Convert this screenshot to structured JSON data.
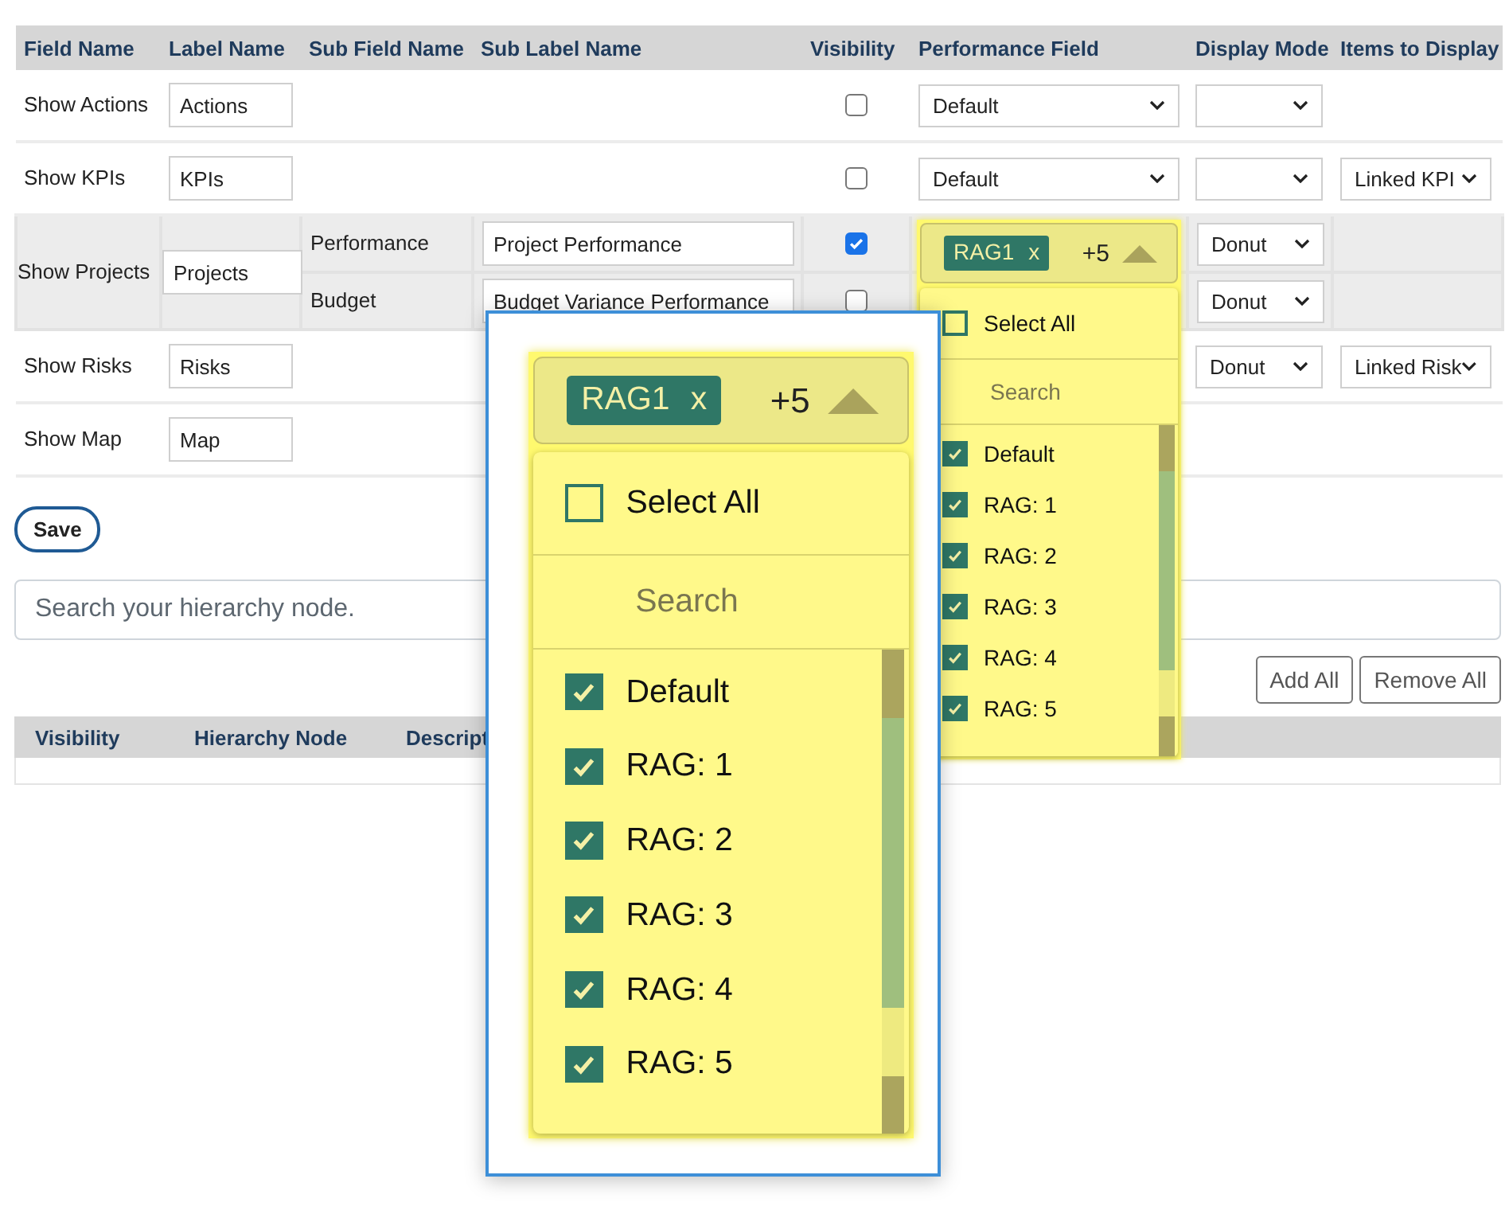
{
  "table": {
    "columns": [
      "Field Name",
      "Label Name",
      "Sub Field Name",
      "Sub Label Name",
      "Visibility",
      "Performance Field",
      "Display Mode",
      "Items to Display"
    ],
    "rows": [
      {
        "field": "Show Actions",
        "label": "Actions",
        "visible": false,
        "performance": "Default",
        "display_mode": {
          "kind": "select"
        }
      },
      {
        "field": "Show KPIs",
        "label": "KPIs",
        "visible": false,
        "performance": "Default",
        "display_mode": {
          "kind": "select"
        },
        "items": {
          "kind": "select",
          "value": "Linked KPI"
        }
      },
      {
        "field": "Show Projects",
        "label": "Projects",
        "sub_rows": [
          {
            "sub_field": "Performance",
            "sub_label": "Project Performance",
            "visible": true,
            "display_mode": {
              "kind": "select",
              "value": "Donut"
            }
          },
          {
            "sub_field": "Budget",
            "sub_label": "Budget Variance Performance",
            "visible": false,
            "display_mode": {
              "kind": "select",
              "value": "Donut"
            }
          }
        ]
      },
      {
        "field": "Show Risks",
        "label": "Risks",
        "display_mode": {
          "kind": "select",
          "value": "Donut"
        },
        "items": {
          "kind": "select",
          "value": "Linked Risk"
        }
      },
      {
        "field": "Show Map",
        "label": "Map"
      }
    ]
  },
  "save_button": "Save",
  "hierarchy_search": {
    "placeholder": "Search your hierarchy node."
  },
  "actions": [
    "Add All",
    "Remove All"
  ],
  "hierarchy_table": {
    "columns": [
      "Visibility",
      "Hierarchy Node",
      "Descript"
    ]
  },
  "performance_dropdown": {
    "chip": "RAG1",
    "chip_remove": "x",
    "more_count": "+5",
    "select_all": {
      "label": "Select All",
      "checked": false
    },
    "search": {
      "placeholder": "Search"
    },
    "options": [
      {
        "label": "Default",
        "checked": true
      },
      {
        "label": "RAG: 1",
        "checked": true
      },
      {
        "label": "RAG: 2",
        "checked": true
      },
      {
        "label": "RAG: 3",
        "checked": true
      },
      {
        "label": "RAG: 4",
        "checked": true
      },
      {
        "label": "RAG: 5",
        "checked": true
      }
    ]
  },
  "zoom_inset": {
    "chip": "RAG1",
    "chip_remove": "x",
    "more_count": "+5",
    "select_all": {
      "label": "Select All",
      "checked": false
    },
    "search": {
      "placeholder": "Search"
    },
    "options": [
      {
        "label": "Default",
        "checked": true
      },
      {
        "label": "RAG: 1",
        "checked": true
      },
      {
        "label": "RAG: 2",
        "checked": true
      },
      {
        "label": "RAG: 3",
        "checked": true
      },
      {
        "label": "RAG: 4",
        "checked": true
      },
      {
        "label": "RAG: 5",
        "checked": true
      }
    ]
  }
}
